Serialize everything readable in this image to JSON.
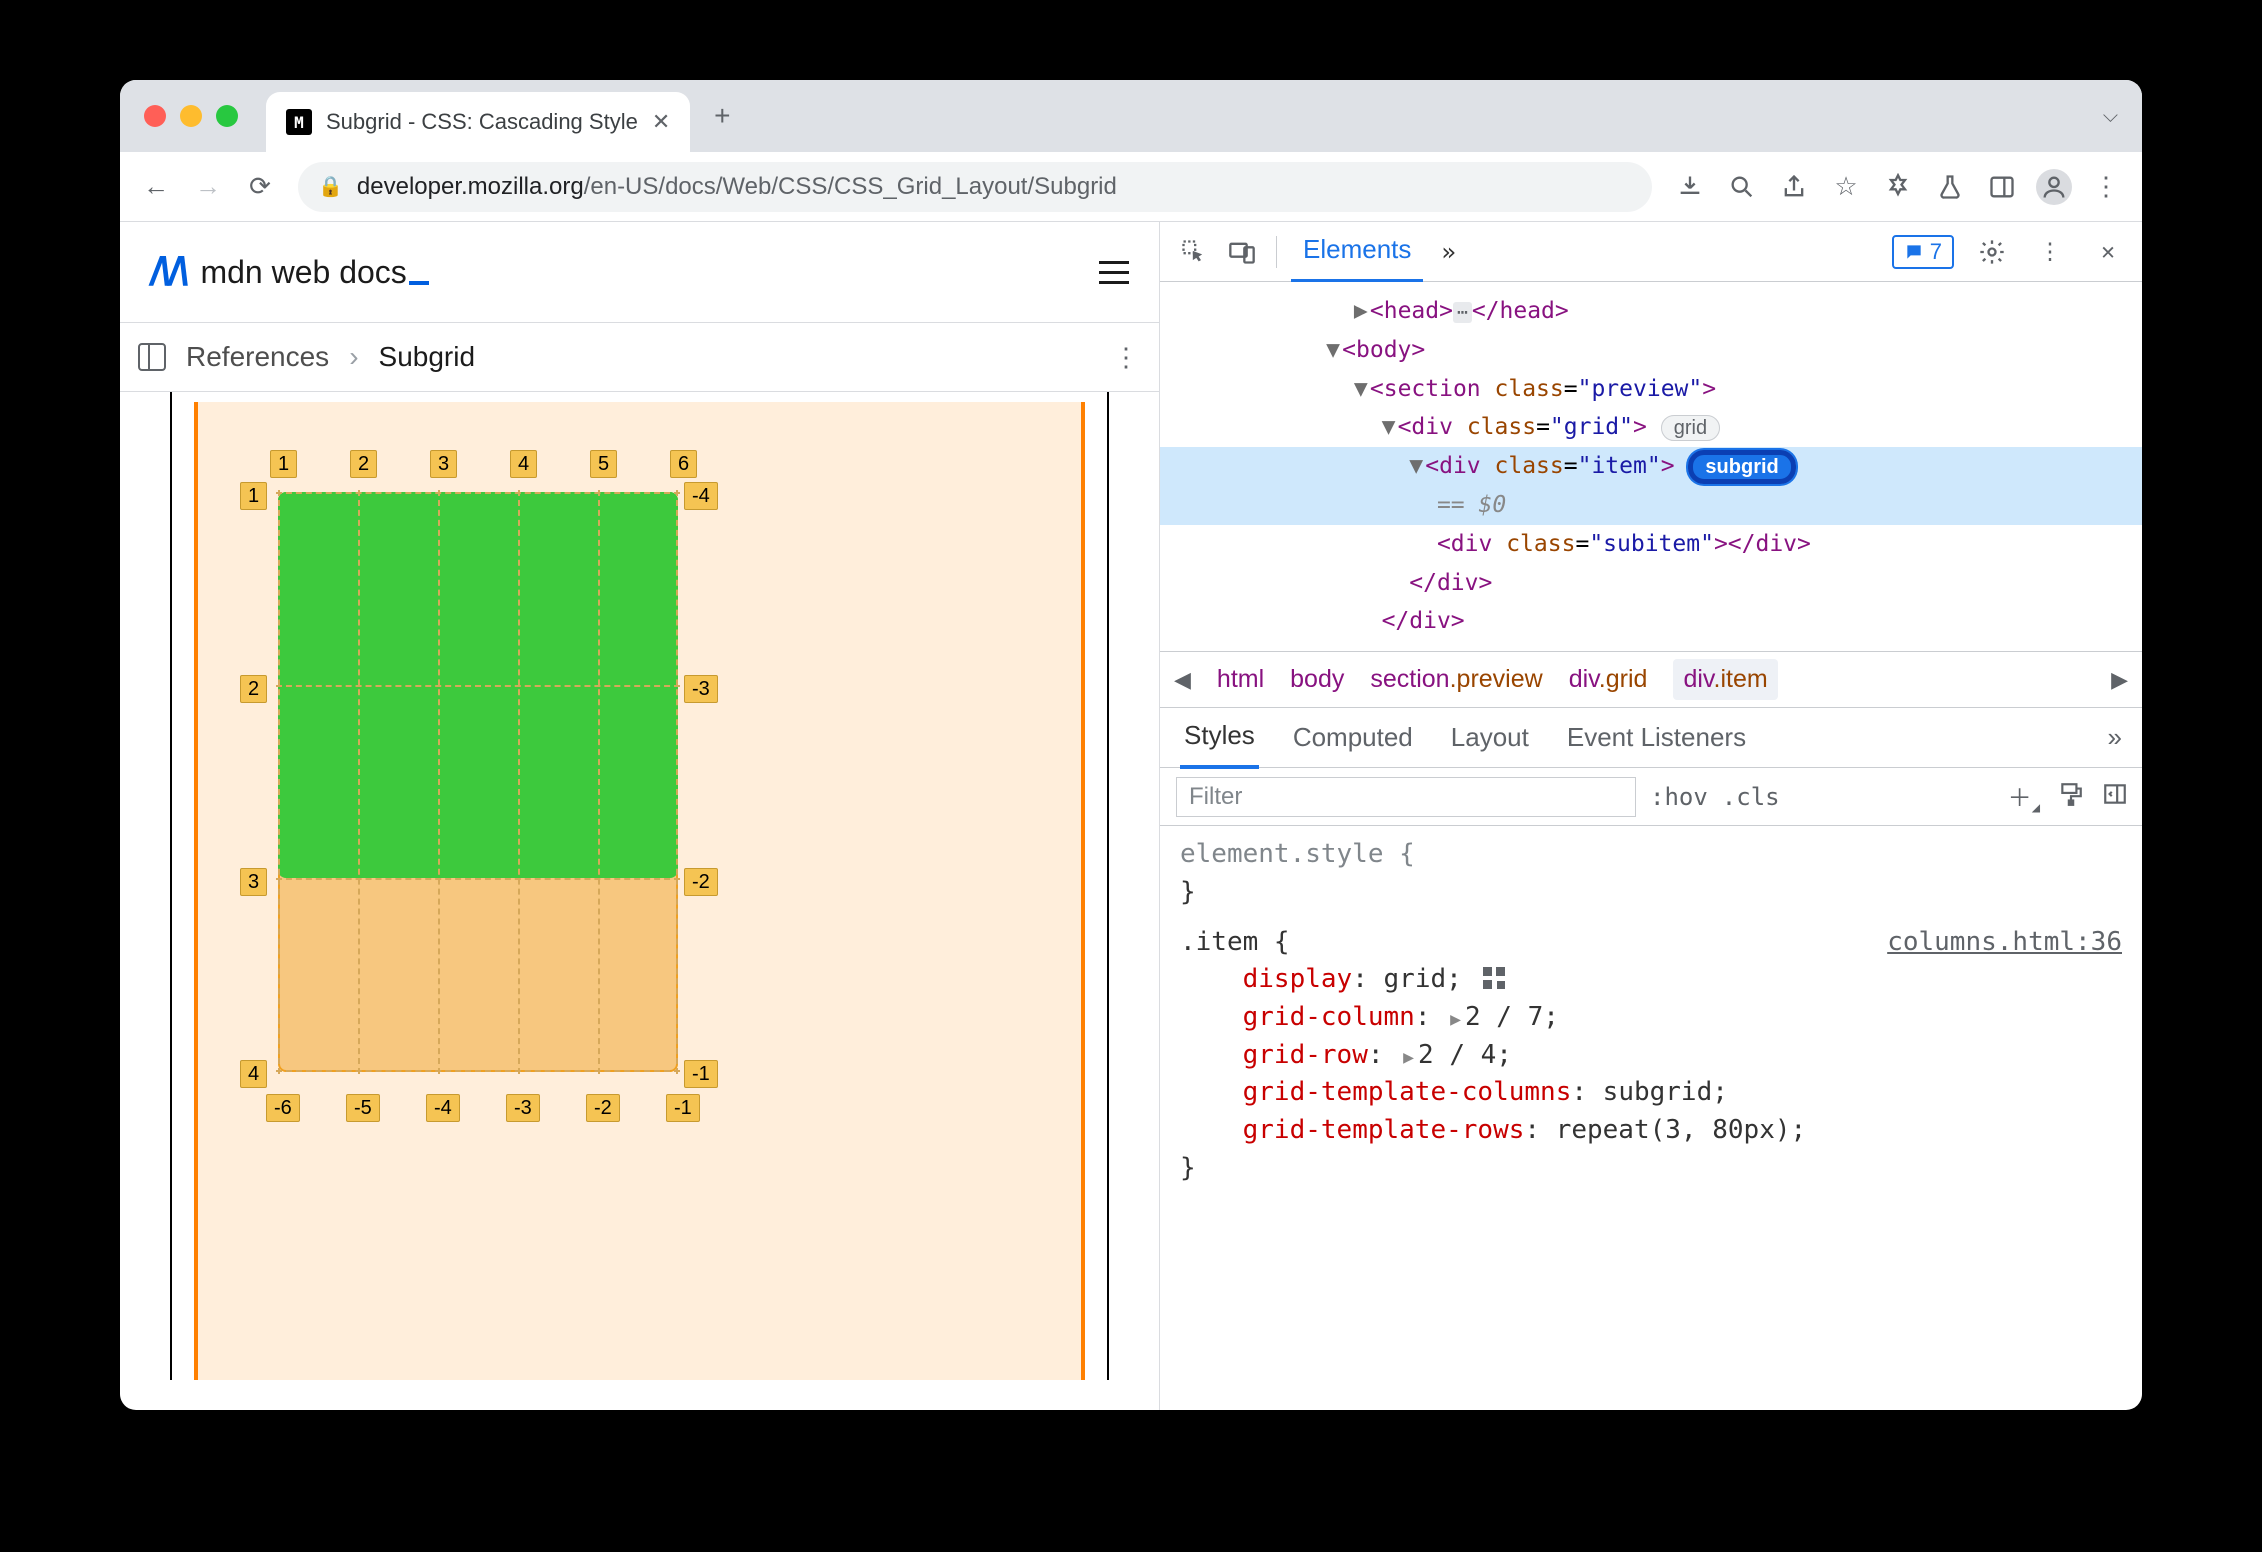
{
  "tab": {
    "title": "Subgrid - CSS: Cascading Style"
  },
  "url": {
    "domain": "developer.mozilla.org",
    "path": "/en-US/docs/Web/CSS/CSS_Grid_Layout/Subgrid"
  },
  "mdn": {
    "logo_text": "mdn web docs"
  },
  "breadcrumb": {
    "references": "References",
    "page": "Subgrid"
  },
  "gridlabels": {
    "top": [
      "1",
      "2",
      "3",
      "4",
      "5",
      "6"
    ],
    "left": [
      "1",
      "2",
      "3",
      "4"
    ],
    "right": [
      "-4",
      "-3",
      "-2",
      "-1"
    ],
    "bottom": [
      "-6",
      "-5",
      "-4",
      "-3",
      "-2",
      "-1"
    ]
  },
  "devtools": {
    "tabs": {
      "elements": "Elements",
      "issues_count": "7"
    },
    "dom": {
      "head_open": "<head>",
      "head_close": "</head>",
      "body_open": "<body>",
      "section": "<section class=\"preview\">",
      "grid": "<div class=\"grid\">",
      "grid_badge": "grid",
      "item": "<div class=\"item\">",
      "item_badge": "subgrid",
      "eqzero": "== $0",
      "subitem": "<div class=\"subitem\"></div>",
      "div_close1": "</div>",
      "div_close2": "</div>"
    },
    "bcpath": [
      {
        "tag": "html"
      },
      {
        "tag": "body"
      },
      {
        "tag": "section",
        "cls": "preview"
      },
      {
        "tag": "div",
        "cls": "grid"
      },
      {
        "tag": "div",
        "cls": "item"
      }
    ],
    "subtabs": {
      "styles": "Styles",
      "computed": "Computed",
      "layout": "Layout",
      "event": "Event Listeners"
    },
    "filter": {
      "placeholder": "Filter",
      "hov": ":hov",
      "cls": ".cls"
    },
    "styles": {
      "element_style": "element.style {",
      "close": "}",
      "item_sel": ".item {",
      "source": "columns.html:36",
      "rules": [
        {
          "prop": "display",
          "val": "grid;",
          "grid": true
        },
        {
          "prop": "grid-column",
          "val": "2 / 7;",
          "tri": true
        },
        {
          "prop": "grid-row",
          "val": "2 / 4;",
          "tri": true
        },
        {
          "prop": "grid-template-columns",
          "val": "subgrid;"
        },
        {
          "prop": "grid-template-rows",
          "val": "repeat(3, 80px);"
        }
      ]
    }
  }
}
